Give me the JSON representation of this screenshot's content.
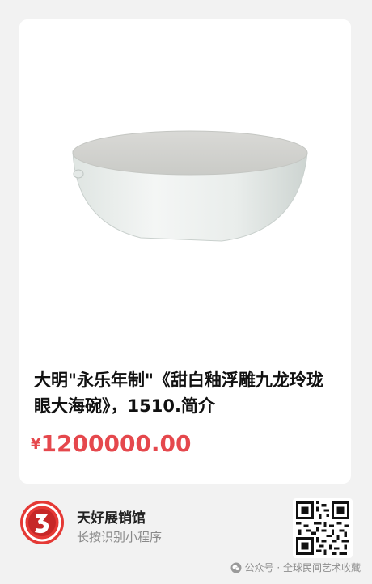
{
  "product": {
    "title": "大明\"永乐年制\"《甜白釉浮雕九龙玲珑眼大海碗》，1510.简介",
    "price_symbol": "¥",
    "price": "1200000.00"
  },
  "store": {
    "name": "天好展销馆",
    "hint": "长按识别小程序"
  },
  "watermark": {
    "text": "公众号 · 全球民间艺术收藏"
  },
  "colors": {
    "price": "#e5484d",
    "logo": "#e53935",
    "background": "#f2f2f2"
  },
  "icons": {
    "product": "white-bowl-image",
    "logo": "red-3-logo-icon",
    "qr": "qr-code-icon",
    "watermark": "wechat-icon"
  }
}
